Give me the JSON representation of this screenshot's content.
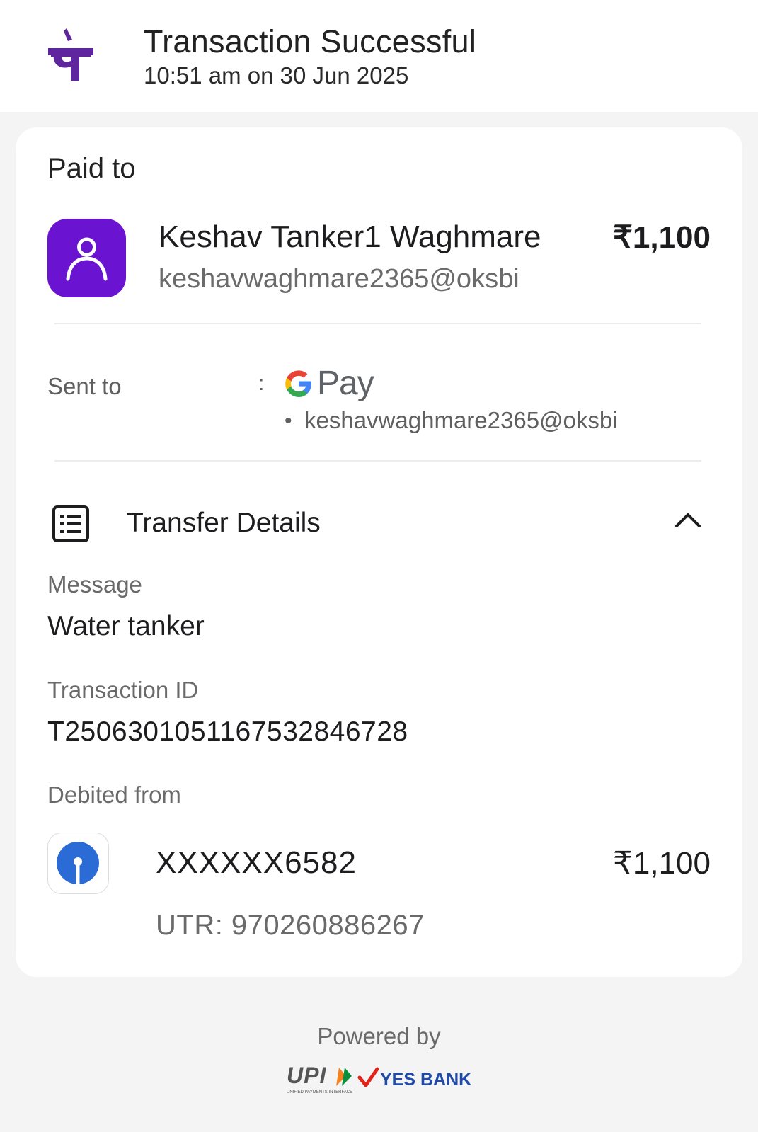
{
  "header": {
    "title": "Transaction Successful",
    "subtitle": "10:51 am on 30 Jun 2025",
    "logo_glyph": "पे",
    "brand_color": "#5f259f"
  },
  "paid_to": {
    "section_label": "Paid to",
    "name": "Keshav Tanker1 Waghmare",
    "vpa": "keshavwaghmare2365@oksbi",
    "amount": "₹1,100",
    "avatar_icon": "user-icon",
    "avatar_color": "#6a14d1"
  },
  "sent_to": {
    "label": "Sent to",
    "separator": ":",
    "app_name": "Pay",
    "app_letter": "G",
    "bullet": "•",
    "vpa": "keshavwaghmare2365@oksbi"
  },
  "transfer_details": {
    "label": "Transfer Details",
    "icon": "list-document-icon",
    "toggle_icon": "chevron-up-icon",
    "message_label": "Message",
    "message_value": "Water tanker",
    "txn_label": "Transaction ID",
    "txn_value": "T2506301051167532846728",
    "debited_label": "Debited from",
    "account": "XXXXXX6582",
    "amount": "₹1,100",
    "utr": "UTR: 970260886267",
    "bank_icon": "sbi-logo-icon",
    "bank_color": "#2b6bd6"
  },
  "footer": {
    "powered_by": "Powered by",
    "upi_text": "UPI",
    "upi_subtext": "UNIFIED PAYMENTS INTERFACE",
    "bank_text": "YES BANK"
  }
}
